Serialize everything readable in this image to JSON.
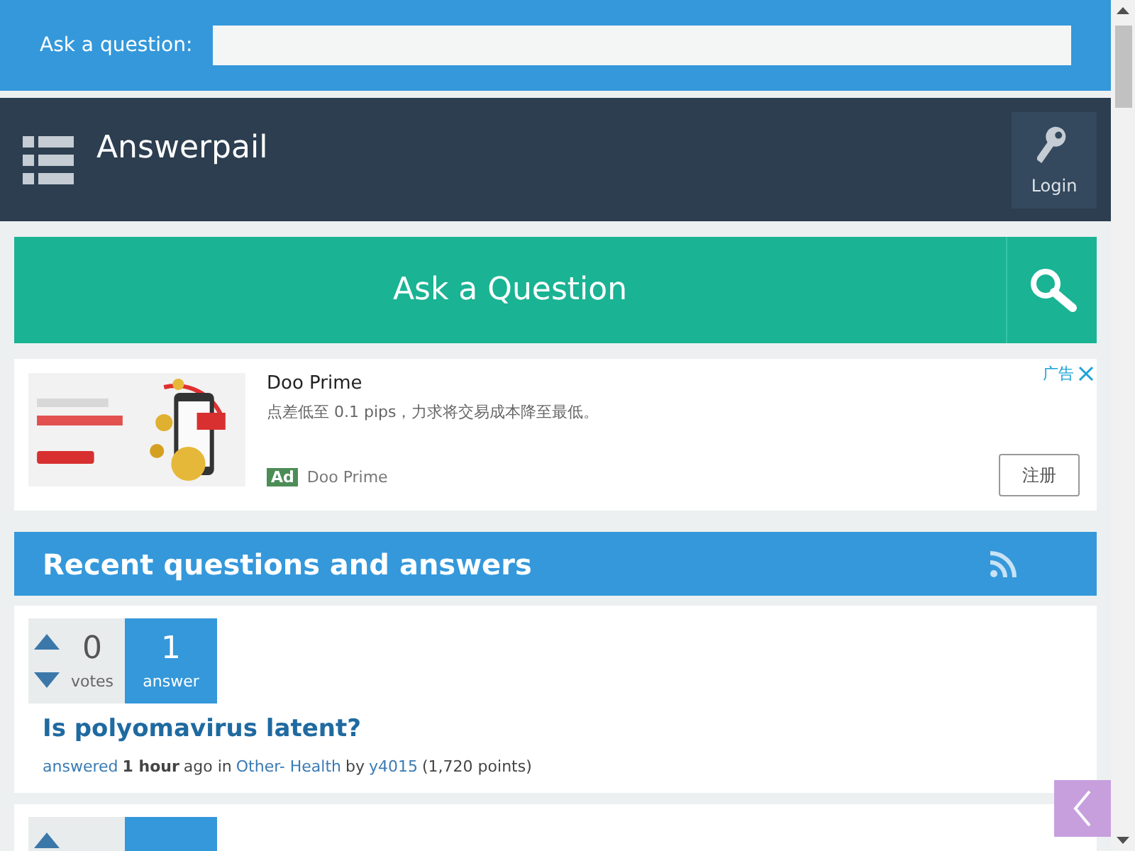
{
  "ask_bar": {
    "label": "Ask a question:"
  },
  "header": {
    "site_name": "Answerpail",
    "login_label": "Login"
  },
  "ask_button": {
    "label": "Ask a Question"
  },
  "ad": {
    "kind": "picture",
    "title": "Doo Prime",
    "text": "点差低至 0.1 pips，力求将交易成本降至最低。",
    "badge": "Ad",
    "advertiser": "Doo Prime",
    "ad_label": "广告",
    "button": "注册"
  },
  "section": {
    "title": "Recent questions and answers"
  },
  "questions": [
    {
      "kind": "question",
      "votes": "0",
      "votes_label": "votes",
      "answers": "1",
      "answers_label": "answer",
      "title": "Is polyomavirus latent?",
      "meta": {
        "action": "answered",
        "time": "1 hour",
        "ago": "ago in",
        "category": "Other- Health",
        "by": "by",
        "user": "y4015",
        "points": "(1,720 points)"
      }
    },
    {
      "kind": "question"
    }
  ]
}
